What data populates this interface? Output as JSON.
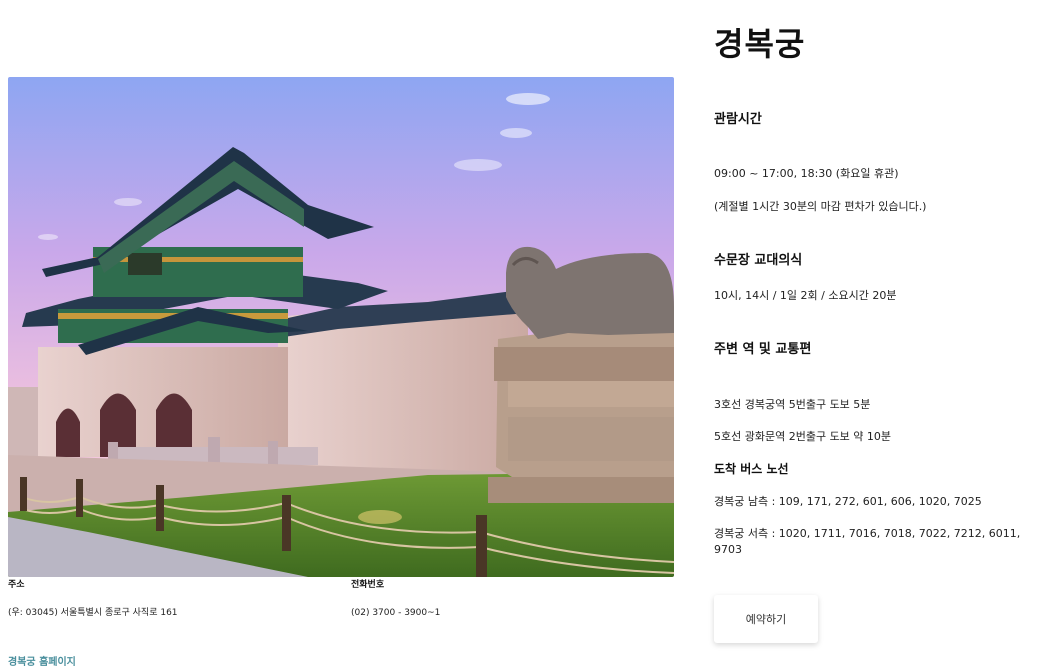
{
  "photo": {
    "alt": ""
  },
  "address": {
    "label": "주소",
    "value": "(우: 03045) 서울특별시 종로구 사직로 161"
  },
  "phone": {
    "label": "전화번호",
    "value": "(02) 3700 - 3900~1"
  },
  "homepage_link": "경복궁 홈페이지",
  "place": {
    "title": "경복궁",
    "hours": {
      "heading": "관람시간",
      "lines": [
        "09:00 ~ 17:00, 18:30 (화요일 휴관)",
        "(계절별 1시간 30분의 마감 편차가 있습니다.)"
      ]
    },
    "ceremony": {
      "heading": "수문장 교대의식",
      "lines": [
        "10시, 14시 / 1일 2회 / 소요시간 20분"
      ]
    },
    "transport": {
      "heading": "주변 역 및 교통편",
      "lines": [
        "3호선 경복궁역 5번출구 도보 5분",
        "5호선 광화문역 2번출구 도보 약 10분"
      ]
    },
    "bus": {
      "heading": "도착 버스 노선",
      "lines": [
        "경복궁 남측 : 109, 171, 272, 601, 606, 1020, 7025",
        "경복궁 서측 : 1020, 1711, 7016, 7018, 7022, 7212, 6011, 9703"
      ]
    }
  },
  "reserve_button": "예약하기",
  "colors": {
    "link": "#4a8f9d",
    "text": "#111111",
    "button_bg": "#ffffff"
  }
}
